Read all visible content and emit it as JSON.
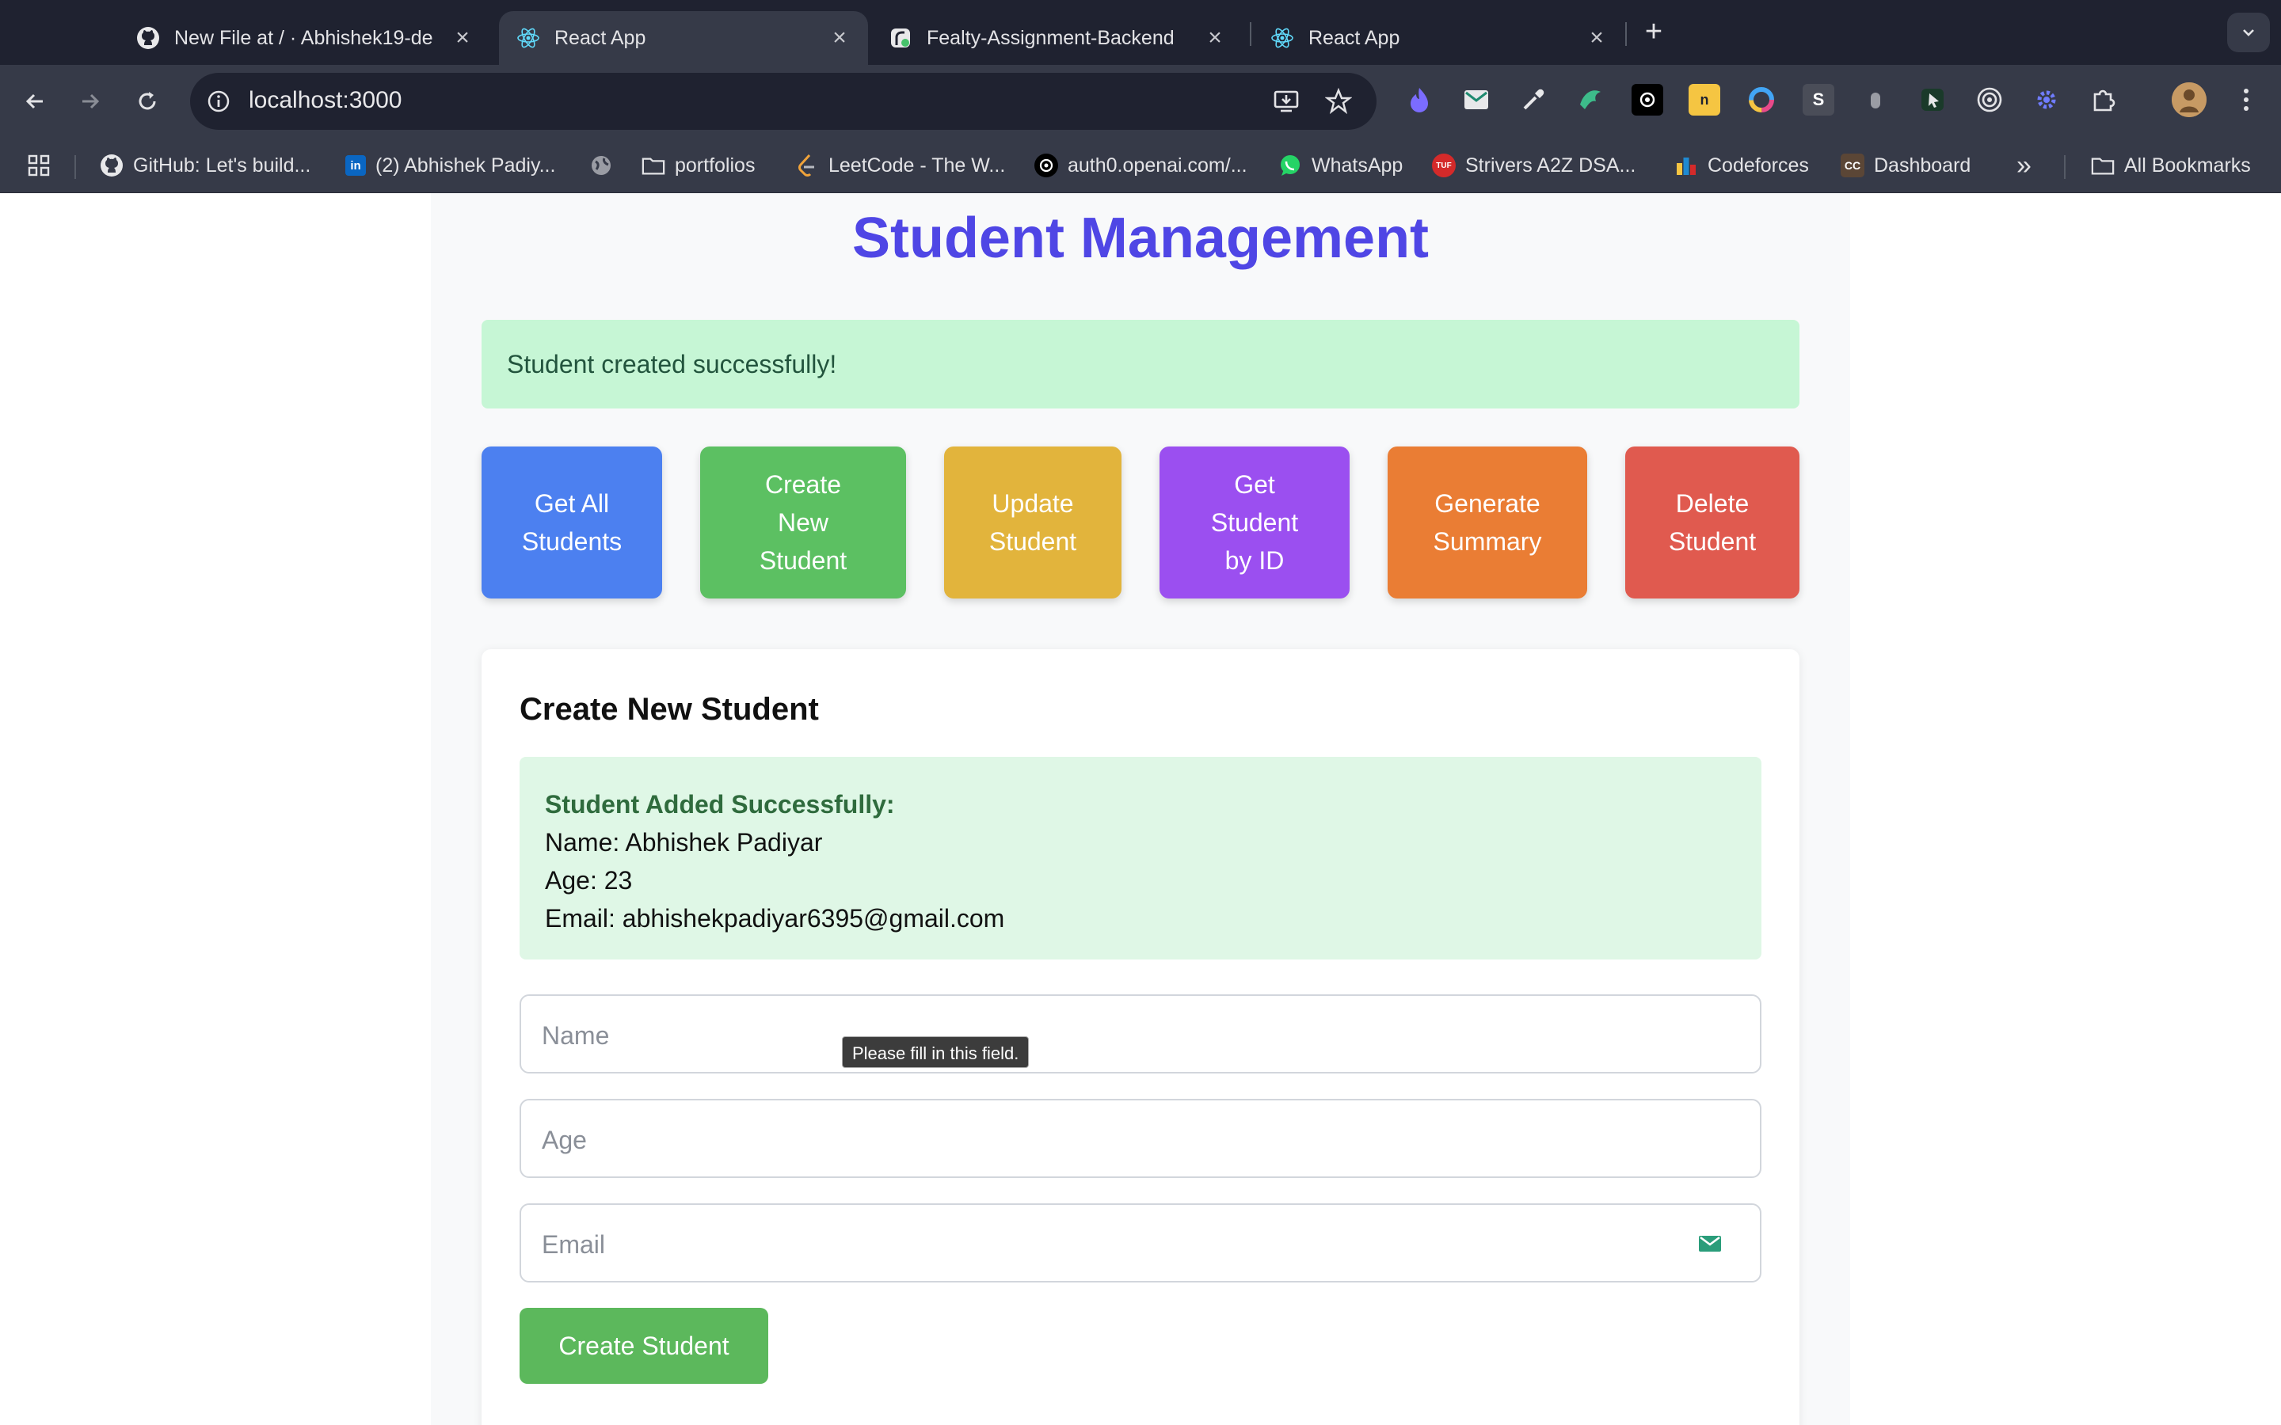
{
  "browser": {
    "tabs": [
      {
        "title": "New File at / · Abhishek19-de",
        "icon": "github-icon"
      },
      {
        "title": "React App",
        "icon": "react-icon",
        "active": true
      },
      {
        "title": "Fealty-Assignment-Backend",
        "icon": "render-icon"
      },
      {
        "title": "React App",
        "icon": "react-icon"
      }
    ],
    "close_glyph": "×",
    "new_tab_glyph": "+",
    "url": "localhost:3000",
    "bookmarks": [
      {
        "label": "GitHub: Let's build...",
        "icon": "github-icon"
      },
      {
        "label": "(2) Abhishek Padiy...",
        "icon": "linkedin-icon"
      },
      {
        "label": "",
        "icon": "globe-icon"
      },
      {
        "label": "portfolios",
        "icon": "folder-icon"
      },
      {
        "label": "LeetCode - The W...",
        "icon": "leetcode-icon"
      },
      {
        "label": "auth0.openai.com/...",
        "icon": "openai-icon"
      },
      {
        "label": "WhatsApp",
        "icon": "whatsapp-icon"
      },
      {
        "label": "Strivers A2Z DSA...",
        "icon": "tuf-icon"
      },
      {
        "label": "Codeforces",
        "icon": "codeforces-icon"
      },
      {
        "label": "Dashboard",
        "icon": "codechef-icon"
      }
    ],
    "more_bookmarks_glyph": "»",
    "all_bookmarks_label": "All Bookmarks",
    "colors": {
      "tabstrip": "#1f2230",
      "toolbar": "#363a48"
    }
  },
  "page": {
    "title": "Student Management",
    "alert": "Student created successfully!",
    "actions": [
      {
        "label": "Get All Students",
        "color": "#4c80f0"
      },
      {
        "label": "Create New Student",
        "color": "#5cc062"
      },
      {
        "label": "Update Student",
        "color": "#e2b43c"
      },
      {
        "label": "Get Student by ID",
        "color": "#9b4ff0"
      },
      {
        "label": "Generate Summary",
        "color": "#ea7d34"
      },
      {
        "label": "Delete Student",
        "color": "#e05a4f"
      }
    ],
    "form": {
      "title": "Create New Student",
      "success_heading": "Student Added Successfully:",
      "success_name": "Name: Abhishek Padiyar",
      "success_age": "Age: 23",
      "success_email": "Email: abhishekpadiyar6395@gmail.com",
      "name_placeholder": "Name",
      "age_placeholder": "Age",
      "email_placeholder": "Email",
      "submit_label": "Create Student",
      "tooltip": "Please fill in this field."
    },
    "colors": {
      "accent": "#4f46e5",
      "success_bg": "#c6f6d5",
      "submit": "#5cb85c"
    }
  }
}
